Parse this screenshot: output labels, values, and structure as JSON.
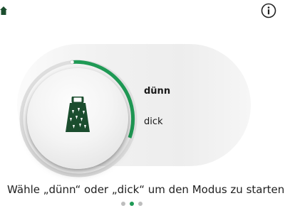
{
  "header": {
    "home_icon": "home-icon",
    "info_icon": "info-icon"
  },
  "selector": {
    "icon": "grater-icon",
    "options": [
      {
        "label": "dünn",
        "selected": true
      },
      {
        "label": "dick",
        "selected": false
      }
    ],
    "progress_color": "#1f9a55",
    "icon_color": "#1b4d2e"
  },
  "instruction_text": "Wähle „dünn“ oder „dick“ um den Modus zu starten",
  "pagination": {
    "total": 3,
    "active_index": 1
  }
}
